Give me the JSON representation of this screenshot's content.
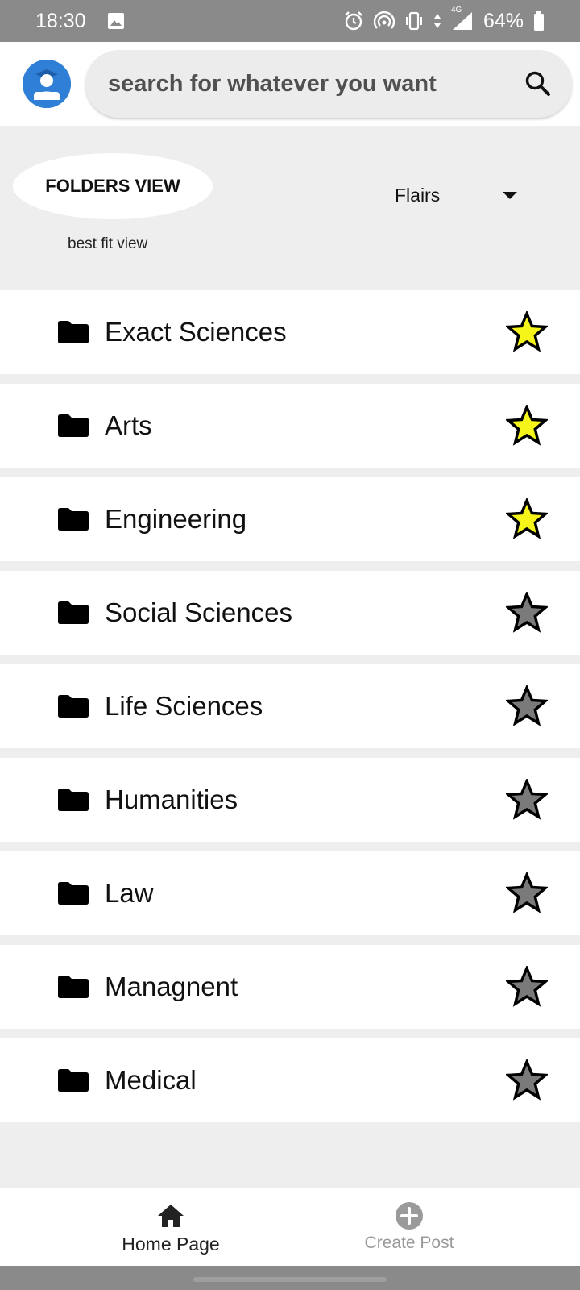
{
  "status_bar": {
    "time": "18:30",
    "icons": [
      "image-icon",
      "alarm-icon",
      "hotspot-icon",
      "vibrate-icon",
      "data-arrows-icon",
      "signal-4g-icon",
      "battery-icon"
    ],
    "network": "4G",
    "battery": "64%"
  },
  "header": {
    "avatar_icon": "user-avatar-icon",
    "search": {
      "placeholder": "search for whatever you want",
      "icon": "search-icon"
    }
  },
  "controls": {
    "folders_view_label": "FOLDERS VIEW",
    "best_fit_label": "best fit view",
    "flairs_dropdown": {
      "selected": "Flairs",
      "icon": "caret-down-icon"
    }
  },
  "folders": [
    {
      "label": "Exact Sciences",
      "starred": true
    },
    {
      "label": "Arts",
      "starred": true
    },
    {
      "label": "Engineering",
      "starred": true
    },
    {
      "label": "Social Sciences",
      "starred": false
    },
    {
      "label": "Life Sciences",
      "starred": false
    },
    {
      "label": "Humanities",
      "starred": false
    },
    {
      "label": "Law",
      "starred": false
    },
    {
      "label": "Managnent",
      "starred": false
    },
    {
      "label": "Medical",
      "starred": false
    }
  ],
  "colors": {
    "star_active": "#f5f51a",
    "star_inactive": "#7a7a7a",
    "avatar_bg": "#2f7fd6",
    "background": "#eeeeee"
  },
  "bottom_nav": {
    "home": {
      "label": "Home Page",
      "icon": "home-icon"
    },
    "create": {
      "label": "Create Post",
      "icon": "add-circle-icon"
    }
  }
}
